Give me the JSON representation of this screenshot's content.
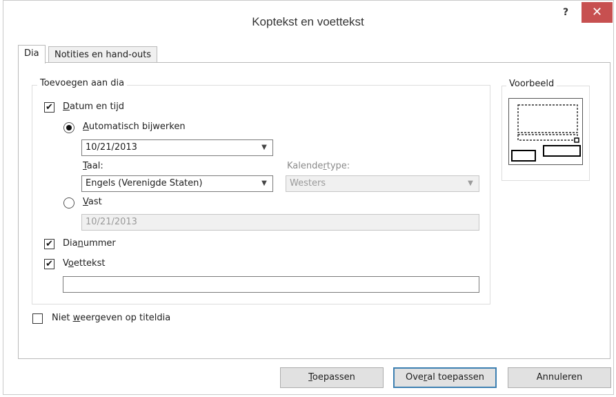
{
  "window": {
    "title": "Koptekst en voettekst",
    "help_label": "?",
    "close_label": "✕"
  },
  "tabs": [
    {
      "label": "Dia",
      "active": true
    },
    {
      "label": "Notities en hand-outs",
      "active": false
    }
  ],
  "group_add": {
    "label": "Toevoegen aan dia",
    "date_time": {
      "label_pre": "",
      "label_u": "D",
      "label_post": "atum en tijd",
      "checked": true
    },
    "auto_update": {
      "label_u": "A",
      "label_post": "utomatisch bijwerken",
      "selected": true
    },
    "auto_date_value": "10/21/2013",
    "language": {
      "label_u": "T",
      "label_post": "aal:",
      "value": "Engels (Verenigde Staten)"
    },
    "calendar": {
      "label_pre": "Kalende",
      "label_u": "r",
      "label_post": "type:",
      "value": "Westers"
    },
    "fixed": {
      "label_u": "V",
      "label_post": "ast",
      "selected": false,
      "value": "10/21/2013"
    },
    "slide_number": {
      "label_pre": "Dia",
      "label_u": "n",
      "label_post": "ummer",
      "checked": true
    },
    "footer": {
      "label_pre": "V",
      "label_u": "o",
      "label_post": "ettekst",
      "checked": true,
      "value": ""
    }
  },
  "no_title_slide": {
    "label_pre": "Niet ",
    "label_u": "w",
    "label_post": "eergeven op titeldia",
    "checked": false
  },
  "preview": {
    "label": "Voorbeeld"
  },
  "buttons": {
    "apply": {
      "label_u": "T",
      "label_post": "oepassen"
    },
    "apply_all": {
      "label_pre": "Ove",
      "label_u": "r",
      "label_post": "al toepassen"
    },
    "cancel": {
      "label": "Annuleren"
    }
  }
}
